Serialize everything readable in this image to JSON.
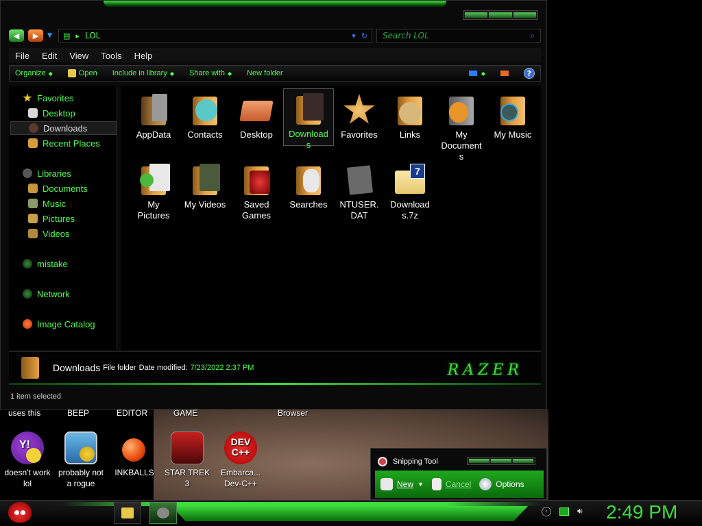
{
  "window": {
    "address": "LOL",
    "search_placeholder": "Search LOL"
  },
  "menu": [
    "File",
    "Edit",
    "View",
    "Tools",
    "Help"
  ],
  "commands": {
    "organize": "Organize",
    "open": "Open",
    "include": "Include in library",
    "share": "Share with",
    "newfolder": "New folder",
    "help": "?"
  },
  "nav": {
    "favorites": "Favorites",
    "desktop": "Desktop",
    "downloads": "Downloads",
    "recent": "Recent Places",
    "libraries": "Libraries",
    "documents": "Documents",
    "music": "Music",
    "pictures": "Pictures",
    "videos": "Videos",
    "mistake": "mistake",
    "network": "Network",
    "catalog": "Image Catalog"
  },
  "files": [
    {
      "name": "AppData"
    },
    {
      "name": "Contacts"
    },
    {
      "name": "Desktop"
    },
    {
      "name": "Download\ns"
    },
    {
      "name": "Favorites"
    },
    {
      "name": "Links"
    },
    {
      "name": "My\nDocument\ns"
    },
    {
      "name": "My Music"
    },
    {
      "name": "My\nPictures"
    },
    {
      "name": "My Videos"
    },
    {
      "name": "Saved\nGames"
    },
    {
      "name": "Searches"
    },
    {
      "name": "NTUSER.\nDAT"
    },
    {
      "name": "Download\ns.7z"
    }
  ],
  "details": {
    "name": "Downloads",
    "type": "File folder",
    "date_label": "Date modified:",
    "date_value": "7/23/2022 2:37 PM",
    "brand": "RAZER"
  },
  "status": "1 item selected",
  "desktop_top_labels": [
    "uses this",
    "BEEP",
    "EDITOR",
    "GAME",
    "Browser"
  ],
  "desktop_icons": [
    {
      "label": "doesn't work\nlol"
    },
    {
      "label": "probably not\na rogue"
    },
    {
      "label": "INKBALLS"
    },
    {
      "label": "STAR TREK\n3"
    },
    {
      "label": "Embarca...\nDev-C++"
    }
  ],
  "desktop_icon_text": {
    "yahoo": "Y!",
    "devcpp": "DEV\nC++"
  },
  "snipping": {
    "title": "Snipping Tool",
    "new": "New",
    "cancel": "Cancel",
    "options": "Options"
  },
  "clock": "2:49 PM",
  "colors": {
    "accent": "#3fdc3f",
    "text_green": "#4cff4c"
  }
}
